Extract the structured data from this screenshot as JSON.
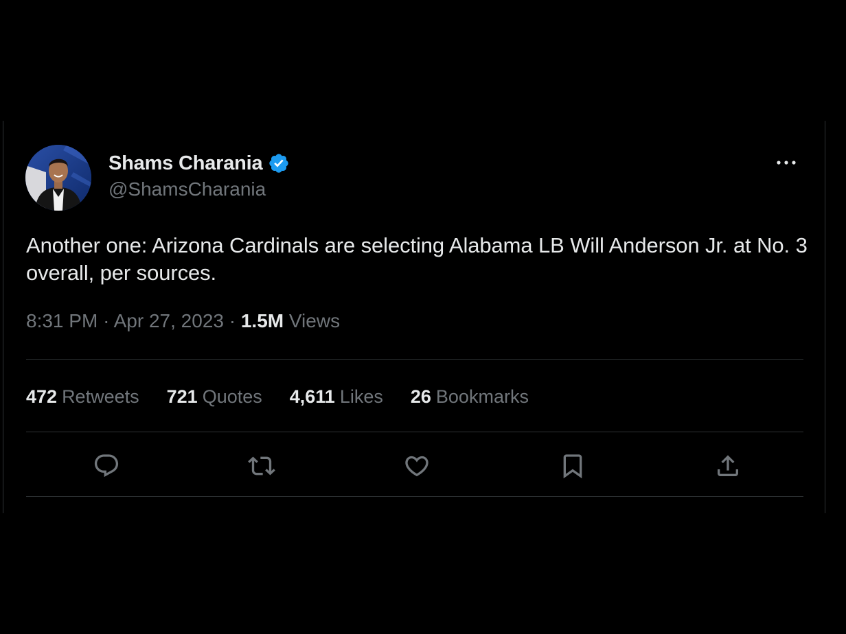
{
  "author": {
    "name": "Shams Charania",
    "handle": "@ShamsCharania",
    "verified": true
  },
  "tweet": {
    "text": "Another one: Arizona Cardinals are selecting Alabama LB Will Anderson Jr. at No. 3 overall, per sources.",
    "time": "8:31 PM",
    "sep1": "·",
    "date": "Apr 27, 2023",
    "sep2": "·",
    "views_count": "1.5M",
    "views_label": "Views"
  },
  "stats": [
    {
      "count": "472",
      "label": "Retweets"
    },
    {
      "count": "721",
      "label": "Quotes"
    },
    {
      "count": "4,611",
      "label": "Likes"
    },
    {
      "count": "26",
      "label": "Bookmarks"
    }
  ],
  "icons": {
    "more": "more-icon",
    "verified": "verified-badge-icon",
    "reply": "reply-icon",
    "retweet": "retweet-icon",
    "like": "heart-icon",
    "bookmark": "bookmark-icon",
    "share": "share-icon"
  },
  "colors": {
    "background": "#000000",
    "text_primary": "#e7e9ea",
    "text_secondary": "#71767b",
    "divider": "#2f3336",
    "verified": "#1d9bf0"
  }
}
